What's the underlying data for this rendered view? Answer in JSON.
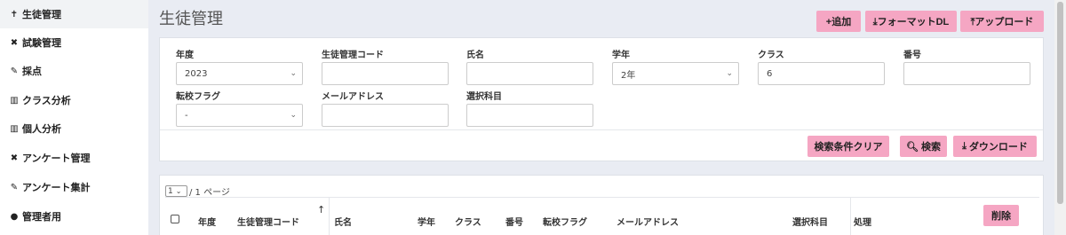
{
  "sidebar": {
    "items": [
      {
        "label": "生徒管理",
        "icon": "✝"
      },
      {
        "label": "試験管理",
        "icon": "✖"
      },
      {
        "label": "採点",
        "icon": "✎"
      },
      {
        "label": "クラス分析",
        "icon": "▥"
      },
      {
        "label": "個人分析",
        "icon": "▥"
      },
      {
        "label": "アンケート管理",
        "icon": "✖"
      },
      {
        "label": "アンケート集計",
        "icon": "✎"
      },
      {
        "label": "管理者用",
        "icon": "●"
      }
    ]
  },
  "header": {
    "title": "生徒管理",
    "add_label": "+追加",
    "format_dl_label": "⤓フォーマットDL",
    "upload_label": "⤒アップロード"
  },
  "search": {
    "year": {
      "label": "年度",
      "value": "2023"
    },
    "student_code": {
      "label": "生徒管理コード",
      "value": ""
    },
    "name": {
      "label": "氏名",
      "value": ""
    },
    "grade": {
      "label": "学年",
      "value": "2年"
    },
    "class": {
      "label": "クラス",
      "value": "6"
    },
    "number": {
      "label": "番号",
      "value": ""
    },
    "transfer_flag": {
      "label": "転校フラグ",
      "value": "-"
    },
    "email": {
      "label": "メールアドレス",
      "value": ""
    },
    "subject": {
      "label": "選択科目",
      "value": ""
    },
    "clear_label": "検索条件クリア",
    "search_label": "検索",
    "download_label": "ダウンロード"
  },
  "list": {
    "page_select": "1",
    "page_text": "/ 1 ページ",
    "columns": [
      "年度",
      "生徒管理コード",
      "氏名",
      "学年",
      "クラス",
      "番号",
      "転校フラグ",
      "メールアドレス",
      "選択科目",
      "処理"
    ],
    "delete_label": "削除",
    "sort_icon": "↑"
  },
  "colors": {
    "accent": "#f5a6c3",
    "background": "#e9ecf3"
  }
}
